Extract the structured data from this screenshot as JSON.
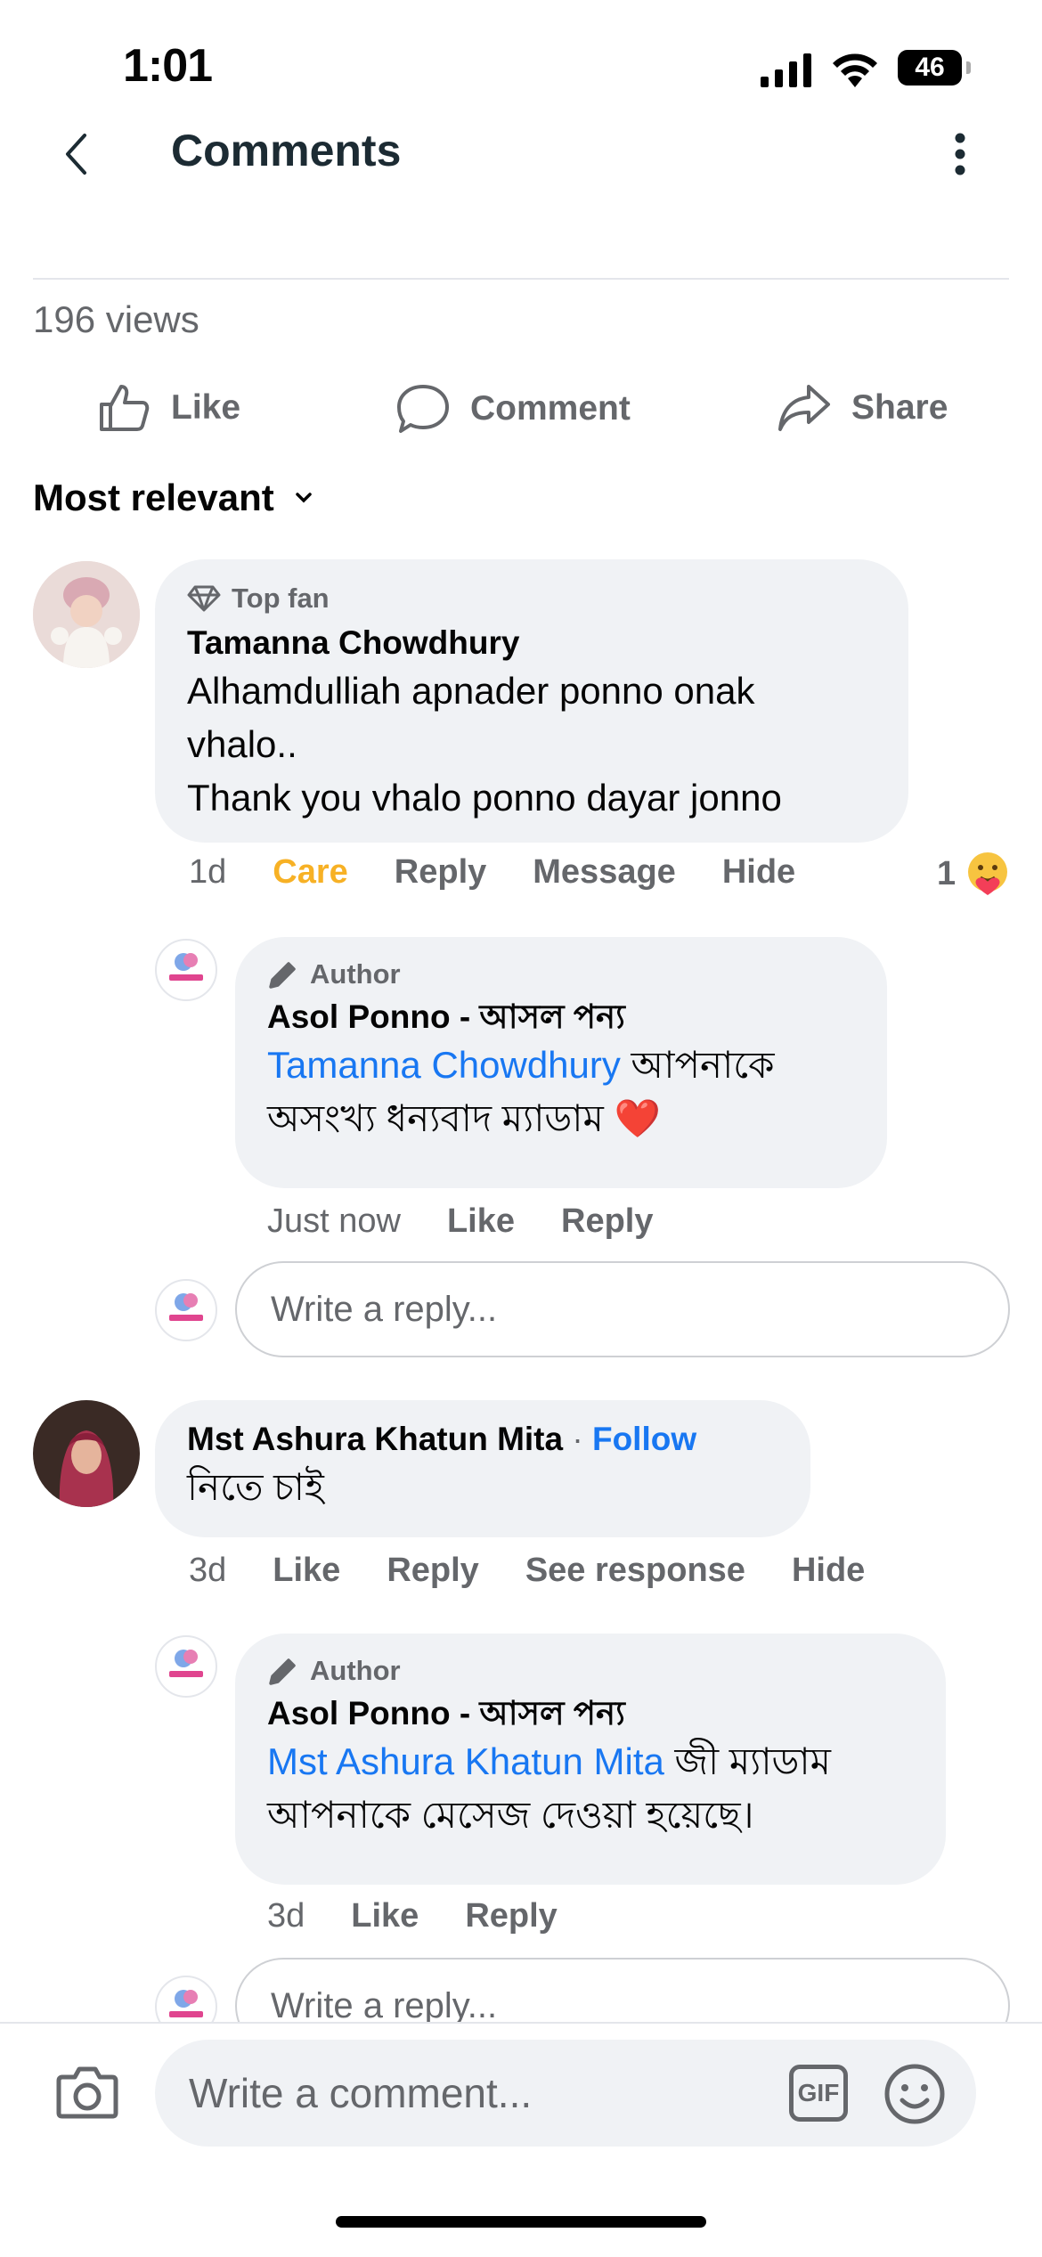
{
  "status_bar": {
    "time": "1:01",
    "battery": "46"
  },
  "header": {
    "title": "Comments"
  },
  "post": {
    "views": "196 views"
  },
  "actions": {
    "like": "Like",
    "comment": "Comment",
    "share": "Share"
  },
  "sort": {
    "label": "Most relevant"
  },
  "comments": [
    {
      "badge": "Top fan",
      "name": "Tamanna Chowdhury",
      "text_lines": [
        "Alhamdulliah apnader ponno onak",
        "vhalo..",
        "Thank you vhalo ponno dayar jonno"
      ],
      "time": "1d",
      "reaction_label": "Care",
      "reaction_color": "#f7b125",
      "reply": "Reply",
      "message": "Message",
      "hide": "Hide",
      "reaction_count": "1",
      "reply_item": {
        "badge": "Author",
        "name": "Asol Ponno - আসল পন্য",
        "mention": "Tamanna Chowdhury",
        "text_after_mention": " আপনাকে",
        "text_line2": "অসংখ্য ধন্যবাদ ম্যাডাম",
        "emoji": "❤️",
        "time": "Just now",
        "like": "Like",
        "reply": "Reply"
      },
      "reply_placeholder": "Write a reply..."
    },
    {
      "name": "Mst Ashura Khatun Mita",
      "follow": "Follow",
      "text": "নিতে চাই",
      "time": "3d",
      "like": "Like",
      "reply": "Reply",
      "see_response": "See response",
      "hide": "Hide",
      "reply_item": {
        "badge": "Author",
        "name": "Asol Ponno - আসল পন্য",
        "mention": "Mst Ashura Khatun Mita",
        "text_after_mention": " জী ম্যাডাম",
        "text_line2": "আপনাকে মেসেজ দেওয়া হয়েছে।",
        "time": "3d",
        "like": "Like",
        "reply": "Reply"
      },
      "reply_placeholder": "Write a reply..."
    }
  ],
  "composer": {
    "placeholder": "Write a comment...",
    "gif": "GIF"
  },
  "colors": {
    "link": "#1877f2",
    "care": "#f7b125",
    "bubble": "#f0f2f5",
    "muted": "#65676b"
  }
}
